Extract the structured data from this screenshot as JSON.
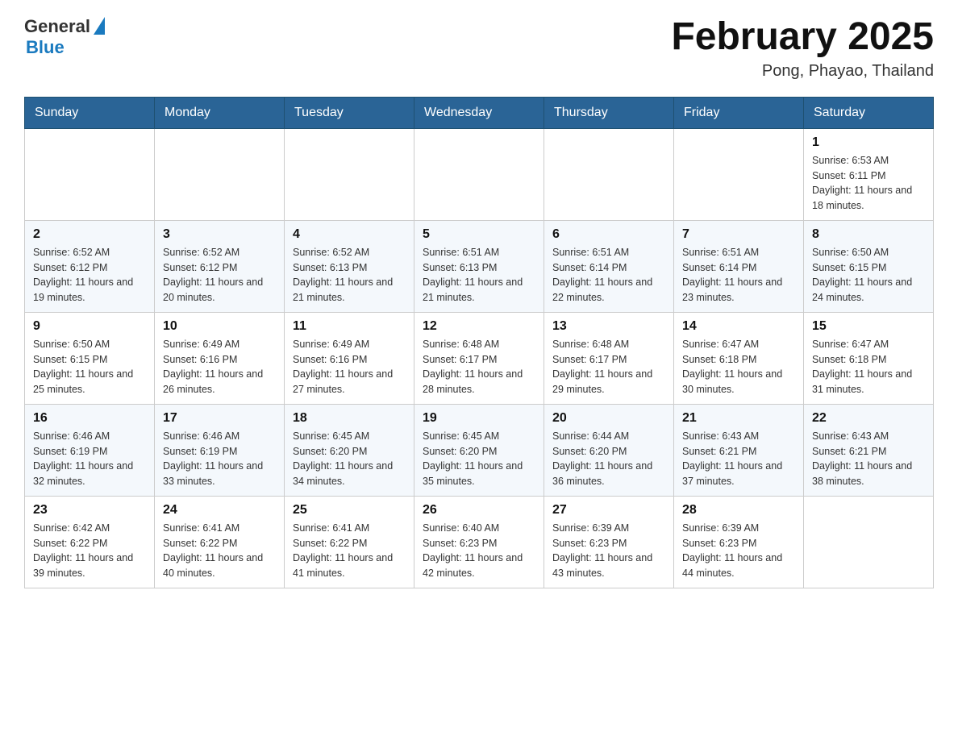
{
  "header": {
    "logo_general": "General",
    "logo_blue": "Blue",
    "month_title": "February 2025",
    "location": "Pong, Phayao, Thailand"
  },
  "days_of_week": [
    "Sunday",
    "Monday",
    "Tuesday",
    "Wednesday",
    "Thursday",
    "Friday",
    "Saturday"
  ],
  "weeks": [
    {
      "days": [
        {
          "number": "",
          "info": ""
        },
        {
          "number": "",
          "info": ""
        },
        {
          "number": "",
          "info": ""
        },
        {
          "number": "",
          "info": ""
        },
        {
          "number": "",
          "info": ""
        },
        {
          "number": "",
          "info": ""
        },
        {
          "number": "1",
          "info": "Sunrise: 6:53 AM\nSunset: 6:11 PM\nDaylight: 11 hours and 18 minutes."
        }
      ]
    },
    {
      "days": [
        {
          "number": "2",
          "info": "Sunrise: 6:52 AM\nSunset: 6:12 PM\nDaylight: 11 hours and 19 minutes."
        },
        {
          "number": "3",
          "info": "Sunrise: 6:52 AM\nSunset: 6:12 PM\nDaylight: 11 hours and 20 minutes."
        },
        {
          "number": "4",
          "info": "Sunrise: 6:52 AM\nSunset: 6:13 PM\nDaylight: 11 hours and 21 minutes."
        },
        {
          "number": "5",
          "info": "Sunrise: 6:51 AM\nSunset: 6:13 PM\nDaylight: 11 hours and 21 minutes."
        },
        {
          "number": "6",
          "info": "Sunrise: 6:51 AM\nSunset: 6:14 PM\nDaylight: 11 hours and 22 minutes."
        },
        {
          "number": "7",
          "info": "Sunrise: 6:51 AM\nSunset: 6:14 PM\nDaylight: 11 hours and 23 minutes."
        },
        {
          "number": "8",
          "info": "Sunrise: 6:50 AM\nSunset: 6:15 PM\nDaylight: 11 hours and 24 minutes."
        }
      ]
    },
    {
      "days": [
        {
          "number": "9",
          "info": "Sunrise: 6:50 AM\nSunset: 6:15 PM\nDaylight: 11 hours and 25 minutes."
        },
        {
          "number": "10",
          "info": "Sunrise: 6:49 AM\nSunset: 6:16 PM\nDaylight: 11 hours and 26 minutes."
        },
        {
          "number": "11",
          "info": "Sunrise: 6:49 AM\nSunset: 6:16 PM\nDaylight: 11 hours and 27 minutes."
        },
        {
          "number": "12",
          "info": "Sunrise: 6:48 AM\nSunset: 6:17 PM\nDaylight: 11 hours and 28 minutes."
        },
        {
          "number": "13",
          "info": "Sunrise: 6:48 AM\nSunset: 6:17 PM\nDaylight: 11 hours and 29 minutes."
        },
        {
          "number": "14",
          "info": "Sunrise: 6:47 AM\nSunset: 6:18 PM\nDaylight: 11 hours and 30 minutes."
        },
        {
          "number": "15",
          "info": "Sunrise: 6:47 AM\nSunset: 6:18 PM\nDaylight: 11 hours and 31 minutes."
        }
      ]
    },
    {
      "days": [
        {
          "number": "16",
          "info": "Sunrise: 6:46 AM\nSunset: 6:19 PM\nDaylight: 11 hours and 32 minutes."
        },
        {
          "number": "17",
          "info": "Sunrise: 6:46 AM\nSunset: 6:19 PM\nDaylight: 11 hours and 33 minutes."
        },
        {
          "number": "18",
          "info": "Sunrise: 6:45 AM\nSunset: 6:20 PM\nDaylight: 11 hours and 34 minutes."
        },
        {
          "number": "19",
          "info": "Sunrise: 6:45 AM\nSunset: 6:20 PM\nDaylight: 11 hours and 35 minutes."
        },
        {
          "number": "20",
          "info": "Sunrise: 6:44 AM\nSunset: 6:20 PM\nDaylight: 11 hours and 36 minutes."
        },
        {
          "number": "21",
          "info": "Sunrise: 6:43 AM\nSunset: 6:21 PM\nDaylight: 11 hours and 37 minutes."
        },
        {
          "number": "22",
          "info": "Sunrise: 6:43 AM\nSunset: 6:21 PM\nDaylight: 11 hours and 38 minutes."
        }
      ]
    },
    {
      "days": [
        {
          "number": "23",
          "info": "Sunrise: 6:42 AM\nSunset: 6:22 PM\nDaylight: 11 hours and 39 minutes."
        },
        {
          "number": "24",
          "info": "Sunrise: 6:41 AM\nSunset: 6:22 PM\nDaylight: 11 hours and 40 minutes."
        },
        {
          "number": "25",
          "info": "Sunrise: 6:41 AM\nSunset: 6:22 PM\nDaylight: 11 hours and 41 minutes."
        },
        {
          "number": "26",
          "info": "Sunrise: 6:40 AM\nSunset: 6:23 PM\nDaylight: 11 hours and 42 minutes."
        },
        {
          "number": "27",
          "info": "Sunrise: 6:39 AM\nSunset: 6:23 PM\nDaylight: 11 hours and 43 minutes."
        },
        {
          "number": "28",
          "info": "Sunrise: 6:39 AM\nSunset: 6:23 PM\nDaylight: 11 hours and 44 minutes."
        },
        {
          "number": "",
          "info": ""
        }
      ]
    }
  ]
}
